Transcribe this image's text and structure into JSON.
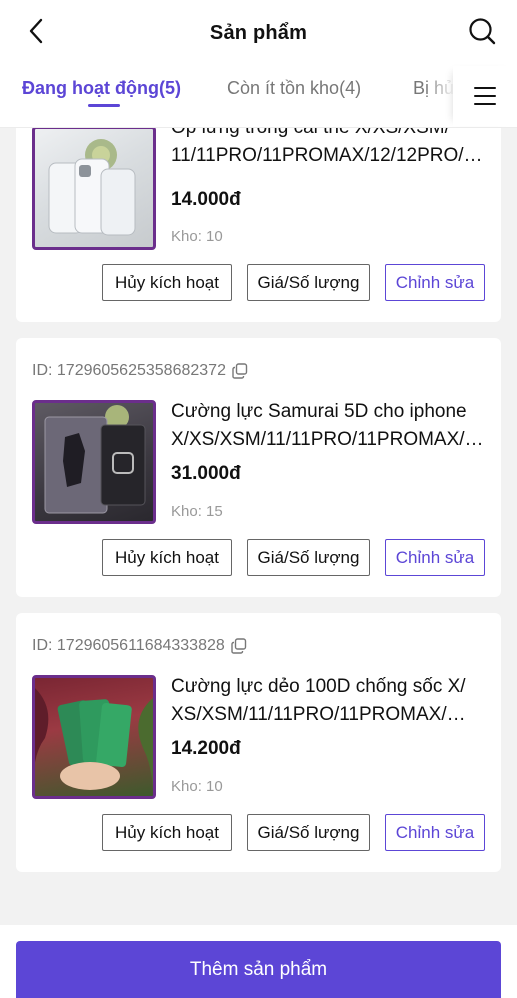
{
  "header": {
    "title": "Sản phẩm"
  },
  "tabs": [
    {
      "label": "Đang hoạt động(5)"
    },
    {
      "label": "Còn ít tồn kho(4)"
    },
    {
      "label": "Bị hủy"
    }
  ],
  "products": [
    {
      "id_label": "",
      "name_line1": "Ốp lưng trong cài thẻ X/XS/XSM/",
      "name_line2": "11/11PRO/11PROMAX/12/12PRO/…",
      "price": "14.000đ",
      "stock": "Kho: 10"
    },
    {
      "id_label": "ID: 1729605625358682372",
      "name_line1": "Cường lực Samurai 5D cho iphone",
      "name_line2": "X/XS/XSM/11/11PRO/11PROMAX/…",
      "price": "31.000đ",
      "stock": "Kho: 15"
    },
    {
      "id_label": "ID: 1729605611684333828",
      "name_line1": "Cường lực dẻo 100D chống sốc X/",
      "name_line2": "XS/XSM/11/11PRO/11PROMAX/…",
      "price": "14.200đ",
      "stock": "Kho: 10"
    }
  ],
  "actions": {
    "deactivate": "Hủy kích hoạt",
    "price_qty": "Giá/Số lượng",
    "edit": "Chỉnh sửa"
  },
  "footer": {
    "add_product": "Thêm sản phẩm"
  },
  "colors": {
    "accent": "#5c46d6",
    "thumb_border": "#6b2e8c",
    "background": "#f2f2f2"
  },
  "icons": [
    "back-arrow-icon",
    "search-icon",
    "menu-icon",
    "copy-icon"
  ]
}
